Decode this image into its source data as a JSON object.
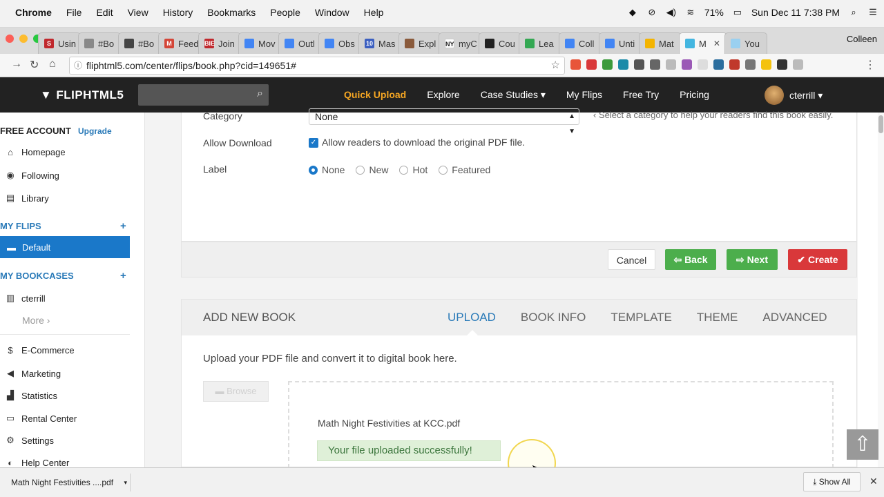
{
  "mac_menubar": {
    "apple": "",
    "app": "Chrome",
    "menus": [
      "File",
      "Edit",
      "View",
      "History",
      "Bookmarks",
      "People",
      "Window",
      "Help"
    ],
    "battery": "71%",
    "clock": "Sun Dec 11  7:38 PM"
  },
  "browser": {
    "tabs": [
      {
        "label": "Usin",
        "favicon_color": "#c0282d",
        "favicon_text": "S"
      },
      {
        "label": "#Bo",
        "favicon_color": "#888888",
        "favicon_text": ""
      },
      {
        "label": "#Bo",
        "favicon_color": "#444444",
        "favicon_text": ""
      },
      {
        "label": "Feed",
        "favicon_color": "#d44638",
        "favicon_text": "M"
      },
      {
        "label": "Join",
        "favicon_color": "#c0282d",
        "favicon_text": "BIE"
      },
      {
        "label": "Mov",
        "favicon_color": "#4285f4",
        "favicon_text": ""
      },
      {
        "label": "Outl",
        "favicon_color": "#4285f4",
        "favicon_text": ""
      },
      {
        "label": "Obs",
        "favicon_color": "#4285f4",
        "favicon_text": ""
      },
      {
        "label": "Mas",
        "favicon_color": "#3b5fc0",
        "favicon_text": "10"
      },
      {
        "label": "Expl",
        "favicon_color": "#8a5a3b",
        "favicon_text": ""
      },
      {
        "label": "myC",
        "favicon_color": "#ffffff",
        "favicon_text": "NY"
      },
      {
        "label": "Cou",
        "favicon_color": "#222222",
        "favicon_text": ""
      },
      {
        "label": "Lea",
        "favicon_color": "#34a853",
        "favicon_text": ""
      },
      {
        "label": "Coll",
        "favicon_color": "#4285f4",
        "favicon_text": ""
      },
      {
        "label": "Unti",
        "favicon_color": "#4285f4",
        "favicon_text": ""
      },
      {
        "label": "Mat",
        "favicon_color": "#f4b400",
        "favicon_text": ""
      },
      {
        "label": "M",
        "favicon_color": "#44b6e0",
        "favicon_text": "",
        "active": true
      },
      {
        "label": "You",
        "favicon_color": "#9ad0f0",
        "favicon_text": ""
      }
    ],
    "tab_close": "✕",
    "profile": "Colleen",
    "url": "fliphtml5.com/center/flips/book.php?cid=149651#"
  },
  "site": {
    "logo": "FLIPHTML5",
    "search_placeholder": "",
    "nav": [
      "Quick Upload",
      "Explore",
      "Case Studies ▾",
      "My Flips",
      "Free Try",
      "Pricing"
    ],
    "user": "cterrill ▾"
  },
  "sidebar": {
    "free_account": "FREE ACCOUNT",
    "upgrade": "Upgrade",
    "main_items": [
      {
        "icon": "home-icon",
        "glyph": "⌂",
        "label": "Homepage"
      },
      {
        "icon": "rss-icon",
        "glyph": "◉",
        "label": "Following"
      },
      {
        "icon": "book-icon",
        "glyph": "▤",
        "label": "Library"
      }
    ],
    "my_flips": "MY FLIPS",
    "default_folder": "Default",
    "my_bookcases": "MY BOOKCASES",
    "bookcase_user": "cterrill",
    "more": "More ›",
    "tools": [
      {
        "icon": "dollar-icon",
        "glyph": "$",
        "label": "E-Commerce"
      },
      {
        "icon": "bullhorn-icon",
        "glyph": "◀",
        "label": "Marketing"
      },
      {
        "icon": "chart-icon",
        "glyph": "▟",
        "label": "Statistics"
      },
      {
        "icon": "card-icon",
        "glyph": "▭",
        "label": "Rental Center"
      },
      {
        "icon": "gear-icon",
        "glyph": "⚙",
        "label": "Settings"
      },
      {
        "icon": "help-icon",
        "glyph": "◐",
        "label": "Help Center"
      }
    ]
  },
  "form": {
    "category_label": "Category",
    "category_value": "None",
    "category_hint": "‹ Select a category to help your readers find this book easily.",
    "download_label": "Allow Download",
    "download_text": "Allow readers to download the original PDF file.",
    "label_label": "Label",
    "label_options": [
      "None",
      "New",
      "Hot",
      "Featured"
    ],
    "cancel": "Cancel",
    "back": "⇦ Back",
    "next": "⇨ Next",
    "create": "✔ Create"
  },
  "add_book": {
    "title": "ADD NEW BOOK",
    "tabs": [
      "UPLOAD",
      "BOOK INFO",
      "TEMPLATE",
      "THEME",
      "ADVANCED"
    ],
    "active_tab": "UPLOAD",
    "description": "Upload your PDF file and convert it to digital book here.",
    "browse": "Browse",
    "file_name": "Math Night Festivities at KCC.pdf",
    "success": "Your file uploaded successfully!"
  },
  "downloads_bar": {
    "file": "Math Night Festivities ....pdf",
    "show_all": "Show All",
    "close": "✕"
  }
}
